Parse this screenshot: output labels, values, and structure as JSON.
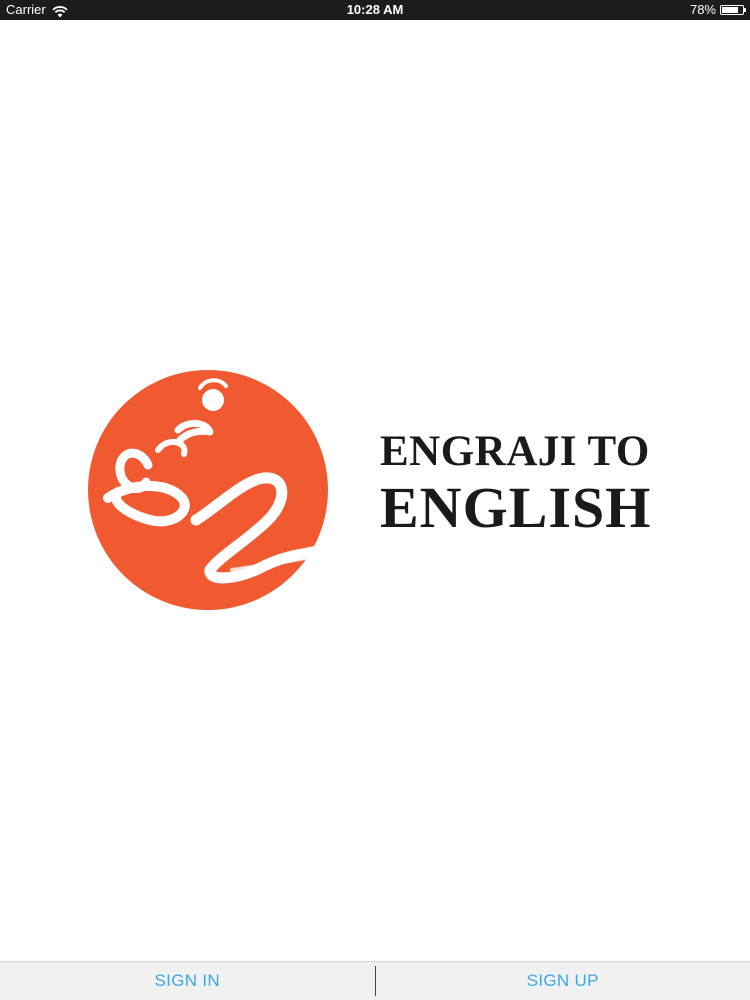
{
  "status_bar": {
    "carrier": "Carrier",
    "wifi_icon": "wifi-icon",
    "time": "10:28 AM",
    "battery_percent": "78%",
    "battery_level": 0.78,
    "background_color": "#1b1c20"
  },
  "logo": {
    "brand_color": "#f15a31",
    "mark_text": "ie",
    "line1": "ENGRAJI TO",
    "line2": "ENGLISH"
  },
  "bottom_bar": {
    "sign_in_label": "SIGN IN",
    "sign_up_label": "SIGN UP",
    "accent_color": "#39a9e6"
  }
}
